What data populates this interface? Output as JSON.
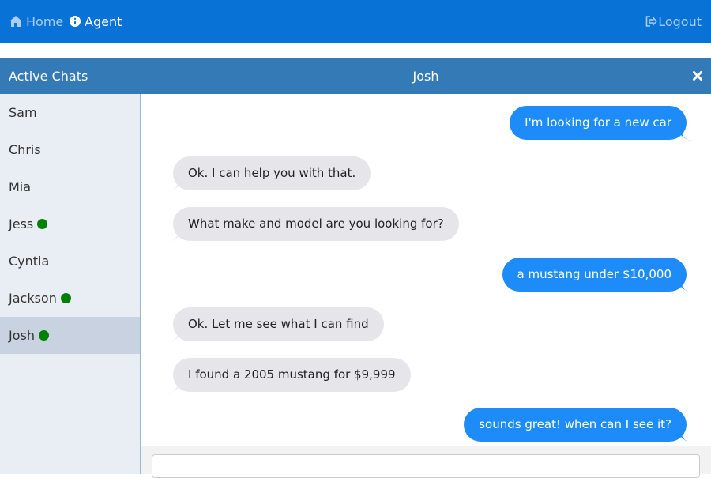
{
  "nav": {
    "home_label": "Home",
    "agent_label": "Agent",
    "logout_label": "Logout",
    "active_item": "agent"
  },
  "chat_header": {
    "list_title": "Active Chats",
    "conversation_title": "Josh"
  },
  "contacts": [
    {
      "name": "Sam",
      "online": false,
      "selected": false
    },
    {
      "name": "Chris",
      "online": false,
      "selected": false
    },
    {
      "name": "Mia",
      "online": false,
      "selected": false
    },
    {
      "name": "Jess",
      "online": true,
      "selected": false
    },
    {
      "name": "Cyntia",
      "online": false,
      "selected": false
    },
    {
      "name": "Jackson",
      "online": true,
      "selected": false
    },
    {
      "name": "Josh",
      "online": true,
      "selected": true
    }
  ],
  "messages": [
    {
      "side": "out",
      "text": "I'm looking for a new car"
    },
    {
      "side": "in",
      "text": "Ok. I can help you with that."
    },
    {
      "side": "in",
      "text": "What make and model are you looking for?"
    },
    {
      "side": "out",
      "text": "a mustang under $10,000"
    },
    {
      "side": "in",
      "text": "Ok. Let me see what I can find"
    },
    {
      "side": "in",
      "text": "I found a 2005 mustang for $9,999"
    },
    {
      "side": "out",
      "text": "sounds great! when can I see it?"
    }
  ],
  "composer": {
    "value": "",
    "placeholder": ""
  },
  "colors": {
    "nav_bg": "#0872d6",
    "header_bg": "#337ab7",
    "outgoing_bubble": "#1d8cf8",
    "incoming_bubble": "#e5e5ea",
    "online_dot": "#008000",
    "selected_contact_bg": "#c9d2e0"
  }
}
